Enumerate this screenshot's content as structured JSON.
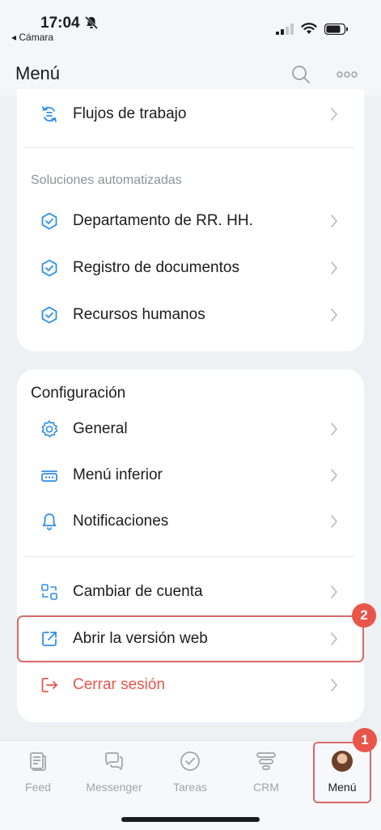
{
  "status": {
    "time": "17:04",
    "back_app": "◂ Cámara"
  },
  "header": {
    "title": "Menú"
  },
  "top_section": {
    "items": [
      {
        "label": "Flujos de trabajo",
        "icon": "workflow-icon"
      }
    ]
  },
  "automated": {
    "header": "Soluciones automatizadas",
    "items": [
      {
        "label": "Departamento de RR. HH.",
        "icon": "hexagon-check-icon"
      },
      {
        "label": "Registro de documentos",
        "icon": "hexagon-check-icon"
      },
      {
        "label": "Recursos humanos",
        "icon": "hexagon-check-icon"
      }
    ]
  },
  "settings": {
    "header": "Configuración",
    "items": [
      {
        "label": "General",
        "icon": "gear-icon"
      },
      {
        "label": "Menú inferior",
        "icon": "bottom-menu-icon"
      },
      {
        "label": "Notificaciones",
        "icon": "bell-icon"
      }
    ]
  },
  "account": {
    "items": [
      {
        "label": "Cambiar de cuenta",
        "icon": "switch-account-icon"
      },
      {
        "label": "Abrir la versión web",
        "icon": "external-link-icon"
      },
      {
        "label": "Cerrar sesión",
        "icon": "logout-icon"
      }
    ]
  },
  "annotations": {
    "badge_menu": "1",
    "badge_web": "2"
  },
  "tabs": [
    {
      "label": "Feed",
      "icon": "feed-icon"
    },
    {
      "label": "Messenger",
      "icon": "messenger-icon"
    },
    {
      "label": "Tareas",
      "icon": "tasks-icon"
    },
    {
      "label": "CRM",
      "icon": "crm-icon"
    },
    {
      "label": "Menú",
      "icon": "avatar",
      "active": true
    }
  ],
  "colors": {
    "accent": "#2f8fe6",
    "danger": "#e8554a",
    "annotation": "#d76a6a"
  }
}
